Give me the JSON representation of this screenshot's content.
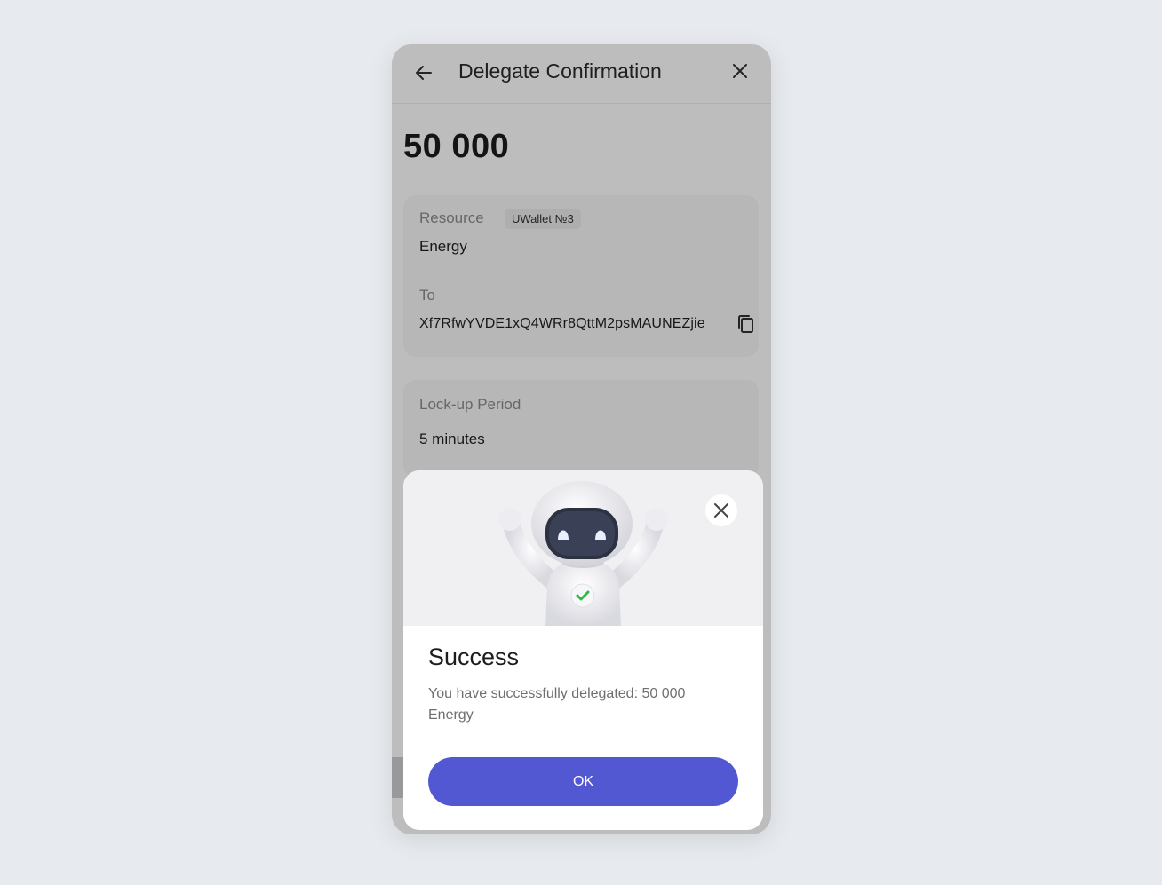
{
  "header": {
    "title": "Delegate Confirmation",
    "back_icon": "arrow-left-icon",
    "close_icon": "close-icon"
  },
  "amount": "50 000",
  "details": {
    "resource_label": "Resource",
    "wallet_badge": "UWallet №3",
    "resource_value": "Energy",
    "to_label": "To",
    "to_address": "Xf7RfwYVDE1xQ4WRr8QttM2psMAUNEZjie",
    "copy_icon": "copy-icon"
  },
  "lockup": {
    "label": "Lock-up Period",
    "value": "5 minutes"
  },
  "modal": {
    "illustration": "robot-success-illustration",
    "close_icon": "close-icon",
    "title": "Success",
    "message": "You have successfully delegated: 50 000 Energy",
    "ok_label": "OK"
  },
  "colors": {
    "primary": "#5258d1",
    "page_bg": "#e7eaee",
    "success_check": "#2fb84a"
  }
}
